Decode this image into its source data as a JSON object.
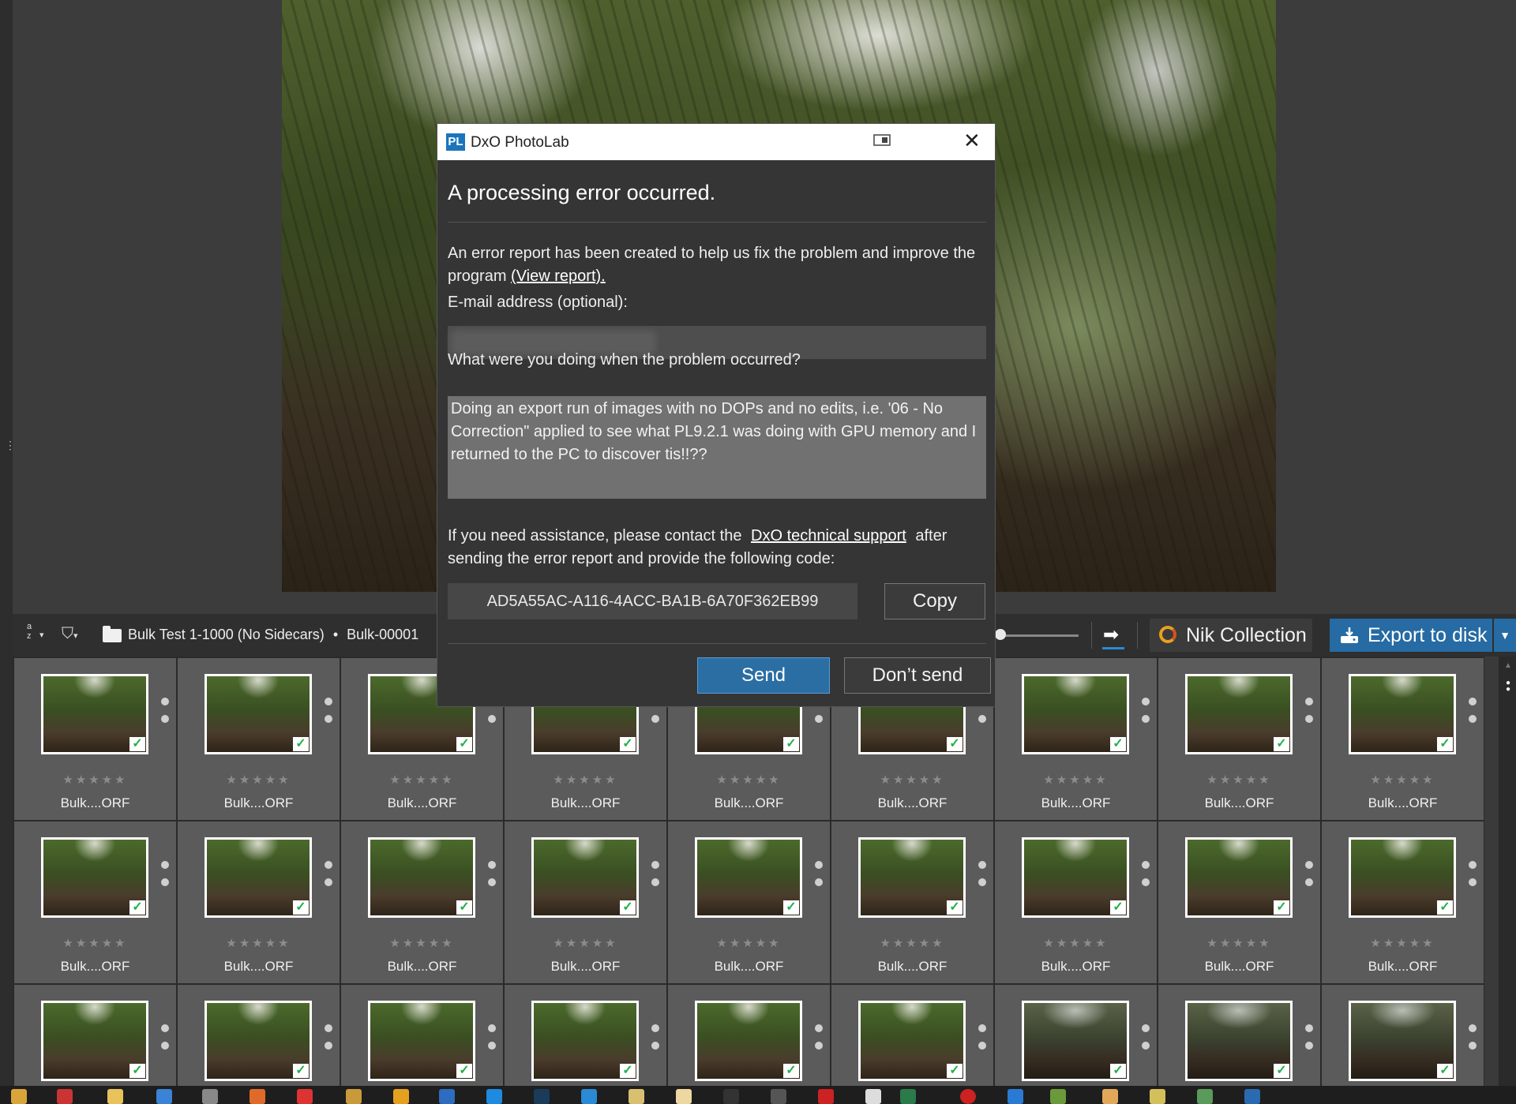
{
  "toolbar": {
    "sort_label": "a\nz",
    "breadcrumb_folder": "Bulk Test 1-1000 (No Sidecars)",
    "breadcrumb_separator": "•",
    "breadcrumb_file": "Bulk-00001",
    "nik_label": "Nik Collection",
    "export_label": "Export to disk"
  },
  "dialog": {
    "window_title": "DxO PhotoLab",
    "app_icon_text": "PL",
    "heading": "A processing error occurred.",
    "report_text": "An error report has been created to help us fix the problem and improve the program",
    "view_report_link": "(View report).",
    "email_label": "E-mail address (optional):",
    "email_value": "",
    "question_label": "What were you doing when the problem occurred?",
    "description_value": "Doing an export run of images with no DOPs and no edits, i.e. '06 - No Correction\" applied to see what PL9.2.1 was doing with GPU memory and I returned to the PC to discover tis!!??",
    "assistance_text_before": "If you need assistance, please contact the",
    "support_link": "DxO technical support",
    "assistance_text_after": "after sending the error report and provide the following code:",
    "error_code": "AD5A55AC-A116-4ACC-BA1B-6A70F362EB99",
    "copy_label": "Copy",
    "send_label": "Send",
    "dont_send_label": "Don’t send"
  },
  "filmstrip": {
    "rating_stars": "★★★★★",
    "check_mark": "✓",
    "file_label": "Bulk....ORF",
    "columns": 9,
    "rows": 3,
    "dark_thumbnails_row3_from_col": 6
  },
  "colors": {
    "accent_blue": "#266ba3",
    "check_green": "#22b04a"
  }
}
